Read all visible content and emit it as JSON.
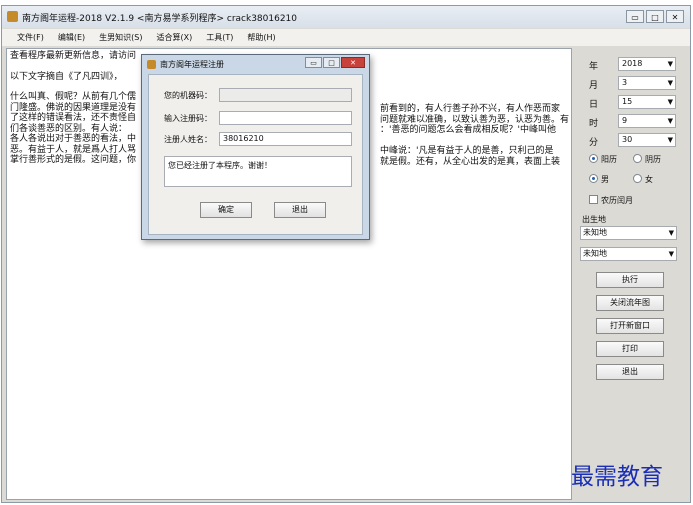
{
  "window": {
    "title": "南方阁年运程-2018  V2.1.9  <南方易学系列程序>  crack38016210",
    "controls": [
      "▭",
      "□",
      "✕"
    ]
  },
  "menu": [
    "文件(F)",
    "编辑(E)",
    "生男知识(S)",
    "适合算(X)",
    "工具(T)",
    "帮助(H)"
  ],
  "text_lines": [
    "查看程序最新更新信息，请访问",
    "",
    "以下文字摘自《了凡四训》，",
    "",
    "什么叫真、假呢？从前有几个儒",
    "门隆盛。佛说的因果道理是没有",
    "了这样的错误看法，还不责怪自",
    "们各谈善恶的区别。有人说：",
    "各人各说出对于善恶的看法，中",
    "恶。有益于人，就是爲人打人骂",
    "掌行善形式的是假。这问题，你"
  ],
  "text_right": [
    "",
    "",
    "",
    "",
    "前看到的，有人行善子孙不兴，有人作恶而家",
    "问题就难以准确，以致认善为恶，认恶为善。有",
    "：'善恶的问题怎么会看成相反呢？'中峰叫他",
    "",
    "中峰说：'凡是有益于人的是善，只利己的是",
    "就是假。还有，从全心出发的是真，表面上装",
    ""
  ],
  "panel": {
    "fields": [
      {
        "label": "年",
        "value": "2018"
      },
      {
        "label": "月",
        "value": "3"
      },
      {
        "label": "日",
        "value": "15"
      },
      {
        "label": "时",
        "value": "9"
      },
      {
        "label": "分",
        "value": "30"
      }
    ],
    "calendar": {
      "solar": "阳历",
      "lunar": "阴历"
    },
    "gender": {
      "male": "男",
      "female": "女"
    },
    "leap_month": "农历闰月",
    "birthplace_label": "出生地",
    "birthplace_1": "未知地",
    "birthplace_2": "未知地",
    "buttons": {
      "execute": "执行",
      "close_chart": "关闭流年图",
      "new_window": "打开新窗口",
      "print": "打印",
      "exit": "退出"
    }
  },
  "dialog": {
    "title": "南方阁年运程注册",
    "machine_label": "您的机器码：",
    "machine_value": "",
    "regcode_label": "输入注册码：",
    "regcode_value": "",
    "name_label": "注册人姓名：",
    "name_value": "38016210",
    "message": "您已经注册了本程序。谢谢！",
    "ok": "确定",
    "exit": "退出"
  },
  "watermark": "最需教育",
  "colors": {
    "accent": "#2a5fa8",
    "watermark": "#1a2fb5",
    "close": "#c7423a"
  }
}
